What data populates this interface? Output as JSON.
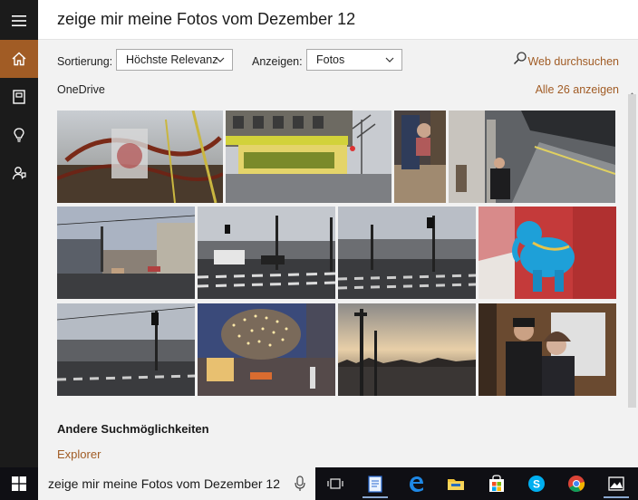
{
  "query": "zeige mir meine Fotos vom Dezember 12",
  "rail": {
    "items": [
      {
        "icon": "menu-icon"
      },
      {
        "icon": "home-icon",
        "active": true
      },
      {
        "icon": "notebook-icon"
      },
      {
        "icon": "lightbulb-icon"
      },
      {
        "icon": "feedback-icon"
      }
    ]
  },
  "filters": {
    "sort_label": "Sortierung:",
    "sort_value": "Höchste Relevanz",
    "show_label": "Anzeigen:",
    "show_value": "Fotos",
    "web_search": "Web durchsuchen"
  },
  "results": {
    "section": "OneDrive",
    "show_all": "Alle 26 anzeigen",
    "photos": [
      {
        "name": "photo-amusement-ride"
      },
      {
        "name": "photo-lit-storefront"
      },
      {
        "name": "photo-person-on-floor"
      },
      {
        "name": "photo-subway-platform"
      },
      {
        "name": "photo-street-crossing-1"
      },
      {
        "name": "photo-street-crossing-2"
      },
      {
        "name": "photo-street-crossing-3"
      },
      {
        "name": "photo-blue-elephant-toy"
      },
      {
        "name": "photo-street-crossing-4"
      },
      {
        "name": "photo-christmas-market"
      },
      {
        "name": "photo-city-skyline"
      },
      {
        "name": "photo-two-people-selfie"
      }
    ]
  },
  "other": {
    "heading": "Andere Suchmöglichkeiten",
    "explorer": "Explorer"
  },
  "taskbar": {
    "search_text": "zeige mir meine Fotos vom Dezember 12",
    "apps": [
      "task-view-icon",
      "notepad-icon",
      "edge-icon",
      "file-explorer-icon",
      "store-icon",
      "skype-icon",
      "chrome-icon",
      "photos-icon"
    ]
  },
  "colors": {
    "accent": "#a15c25",
    "rail_bg": "#1b1b1b",
    "panel_bg": "#f2f2f2"
  }
}
